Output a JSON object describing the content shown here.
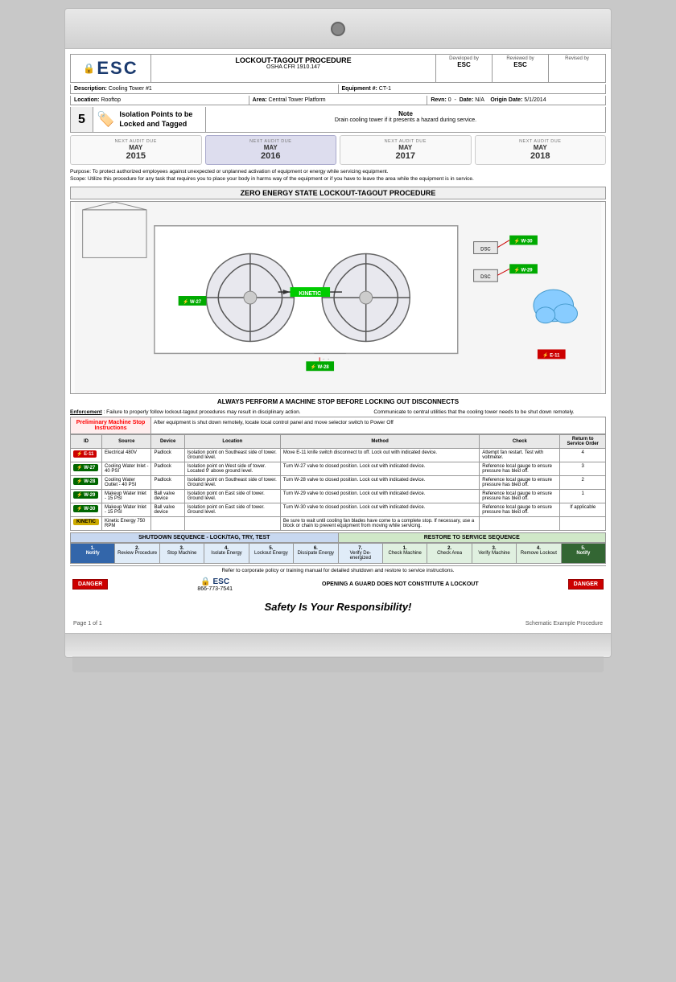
{
  "binder": {
    "hole_label": "binder-hole"
  },
  "header": {
    "logo": "ESC",
    "title_main": "LOCKOUT-TAGOUT PROCEDURE",
    "title_sub": "OSHA CFR 1910.147",
    "developed_by_label": "Developed by",
    "developed_by": "ESC",
    "reviewed_by_label": "Reviewed by",
    "reviewed_by": "ESC",
    "revised_by_label": "Revised by",
    "revised_by": ""
  },
  "info": {
    "description_label": "Description:",
    "description": "Cooling Tower #1",
    "equipment_label": "Equipment #:",
    "equipment": "CT-1",
    "location_label": "Location:",
    "location": "Rooftop",
    "area_label": "Area:",
    "area": "Central Tower Platform",
    "revn_label": "Revn:",
    "revn": "0",
    "date_label": "Date:",
    "date": "N/A",
    "origin_label": "Origin Date:",
    "origin": "5/1/2014"
  },
  "step": {
    "number": "5",
    "title": "Isolation Points to be Locked and Tagged",
    "note_label": "Note",
    "note_text": "Drain cooling tower if it presents a hazard during service."
  },
  "audit_dates": [
    {
      "label": "NEXT AUDIT DUE",
      "month": "MAY",
      "year": "2015",
      "active": false
    },
    {
      "label": "NEXT AUDIT DUE",
      "month": "MAY",
      "year": "2016",
      "active": true
    },
    {
      "label": "NEXT AUDIT DUE",
      "month": "MAY",
      "year": "2017",
      "active": false
    },
    {
      "label": "NEXT AUDIT DUE",
      "month": "MAY",
      "year": "2018",
      "active": false
    }
  ],
  "purpose": "Purpose: To protect authorized employees against unexpected or unplanned activation of equipment or energy while servicing equipment.",
  "scope": "Scope: Utilize this procedure for any task that requires you to place your body in harms way of the equipment or if you have to leave the area while the equipment is in service.",
  "zero_energy_header": "ZERO ENERGY STATE LOCKOUT-TAGOUT PROCEDURE",
  "machine_stop": "ALWAYS PERFORM A MACHINE STOP BEFORE LOCKING OUT DISCONNECTS",
  "enforcement": {
    "left": "Enforcement: Failure to properly follow lockout-tagout procedures may result in disciplinary action.",
    "right": "Communicate to central utilities that the cooling tower needs to be shut down remotely."
  },
  "prelim": {
    "left_title": "Preliminary Machine Stop Instructions",
    "right": "After equipment is shut down remotely, locate local control panel and move selector switch to Power Off"
  },
  "table": {
    "headers": [
      "ID",
      "Source",
      "Device",
      "Location",
      "Method",
      "Check",
      "Return to Service Order"
    ],
    "rows": [
      {
        "id": "E-11",
        "id_color": "red",
        "source": "Electrical 480V",
        "device": "Padlock",
        "location": "Isolation point on Southeast side of tower. Ground level.",
        "method": "Move E-11 knife switch disconnect to off. Lock out with indicated device.",
        "check": "Attempt fan restart. Test with voltmeter.",
        "order": "4"
      },
      {
        "id": "W-27",
        "id_color": "green",
        "source": "Cooling Water Inlet - 40 PSI",
        "device": "Padlock",
        "location": "Isolation point on West side of tower. Located 9' above ground level.",
        "method": "Turn W-27 valve to closed position. Lock out with indicated device.",
        "check": "Reference local gauge to ensure pressure has bled off.",
        "order": "3"
      },
      {
        "id": "W-28",
        "id_color": "green",
        "source": "Cooling Water Outlet - 40 PSI",
        "device": "Padlock",
        "location": "Isolation point on Southeast side of tower. Ground level.",
        "method": "Turn W-28 valve to closed position. Lock out with indicated device.",
        "check": "Reference local gauge to ensure pressure has bled off.",
        "order": "2"
      },
      {
        "id": "W-29",
        "id_color": "green",
        "source": "Makeup Water Inlet - 15 PSI",
        "device": "Ball valve device",
        "location": "Isolation point on East side of tower. Ground level.",
        "method": "Turn W-29 valve to closed position. Lock out with indicated device.",
        "check": "Reference local gauge to ensure pressure has bled off.",
        "order": "1"
      },
      {
        "id": "W-30",
        "id_color": "green",
        "source": "Makeup Water Inlet - 15 PSI",
        "device": "Ball valve device",
        "location": "Isolation point on East side of tower. Ground level.",
        "method": "Turn W-30 valve to closed position. Lock out with indicated device.",
        "check": "Reference local gauge to ensure pressure has bled off.",
        "order": "If applicable"
      },
      {
        "id": "KINETIC",
        "id_color": "yellow",
        "source": "Kinetic Energy 750 RPM",
        "device": "",
        "location": "",
        "method": "Be sure to wait until cooling fan blades have come to a complete stop. If necessary, use a block or chain to prevent equipment from moving while servicing.",
        "check": "",
        "order": ""
      }
    ]
  },
  "shutdown_sequence": {
    "left_title": "SHUTDOWN SEQUENCE - LOCK/TAG, TRY, TEST",
    "right_title": "RESTORE TO SERVICE SEQUENCE",
    "steps_left": [
      {
        "num": "1.",
        "label": "Notify"
      },
      {
        "num": "2.",
        "label": "Review Procedure"
      },
      {
        "num": "3.",
        "label": "Stop Machine"
      },
      {
        "num": "4.",
        "label": "Isolate Energy"
      },
      {
        "num": "5.",
        "label": "Lockout Energy"
      },
      {
        "num": "6.",
        "label": "Dissipate Energy"
      },
      {
        "num": "7.",
        "label": "Verify De-energized"
      }
    ],
    "steps_right": [
      {
        "num": "1.",
        "label": "Check Machine"
      },
      {
        "num": "2.",
        "label": "Check Area"
      },
      {
        "num": "3.",
        "label": "Verify Machine"
      },
      {
        "num": "4.",
        "label": "Remove Lockout"
      },
      {
        "num": "5.",
        "label": "Notify"
      }
    ]
  },
  "refer": "Refer to corporate policy or training manual for detailed shutdown and restore to service instructions.",
  "footer": {
    "danger": "DANGER",
    "logo": "ESC",
    "phone": "866-773-7541",
    "notice": "OPENING A GUARD DOES NOT CONSTITUTE A LOCKOUT"
  },
  "safety": "Safety Is Your Responsibility!",
  "page_footer": {
    "page": "Page 1 of 1",
    "schematic": "Schematic Example Procedure"
  }
}
